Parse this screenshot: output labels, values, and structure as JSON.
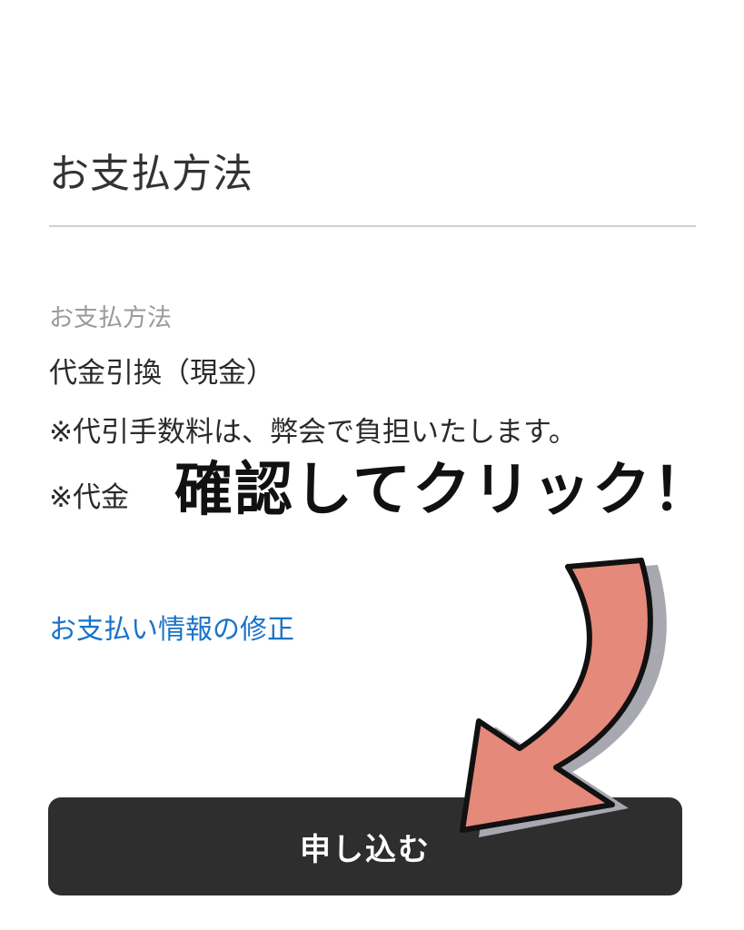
{
  "payment": {
    "section_title": "お支払方法",
    "field_label": "お支払方法",
    "field_value": "代金引換（現金）",
    "note_1": "※代引手数料は、弊会で負担いたします。",
    "note_2": "※代金",
    "edit_link": "お支払い情報の修正"
  },
  "actions": {
    "submit_label": "申し込む"
  },
  "annotation": {
    "callout_text": "確認してクリック！",
    "arrow_color": "#e5897a",
    "arrow_shadow_color": "#a8a8b0"
  },
  "colors": {
    "link": "#1a73c9",
    "button_bg": "#2e2e2e"
  }
}
